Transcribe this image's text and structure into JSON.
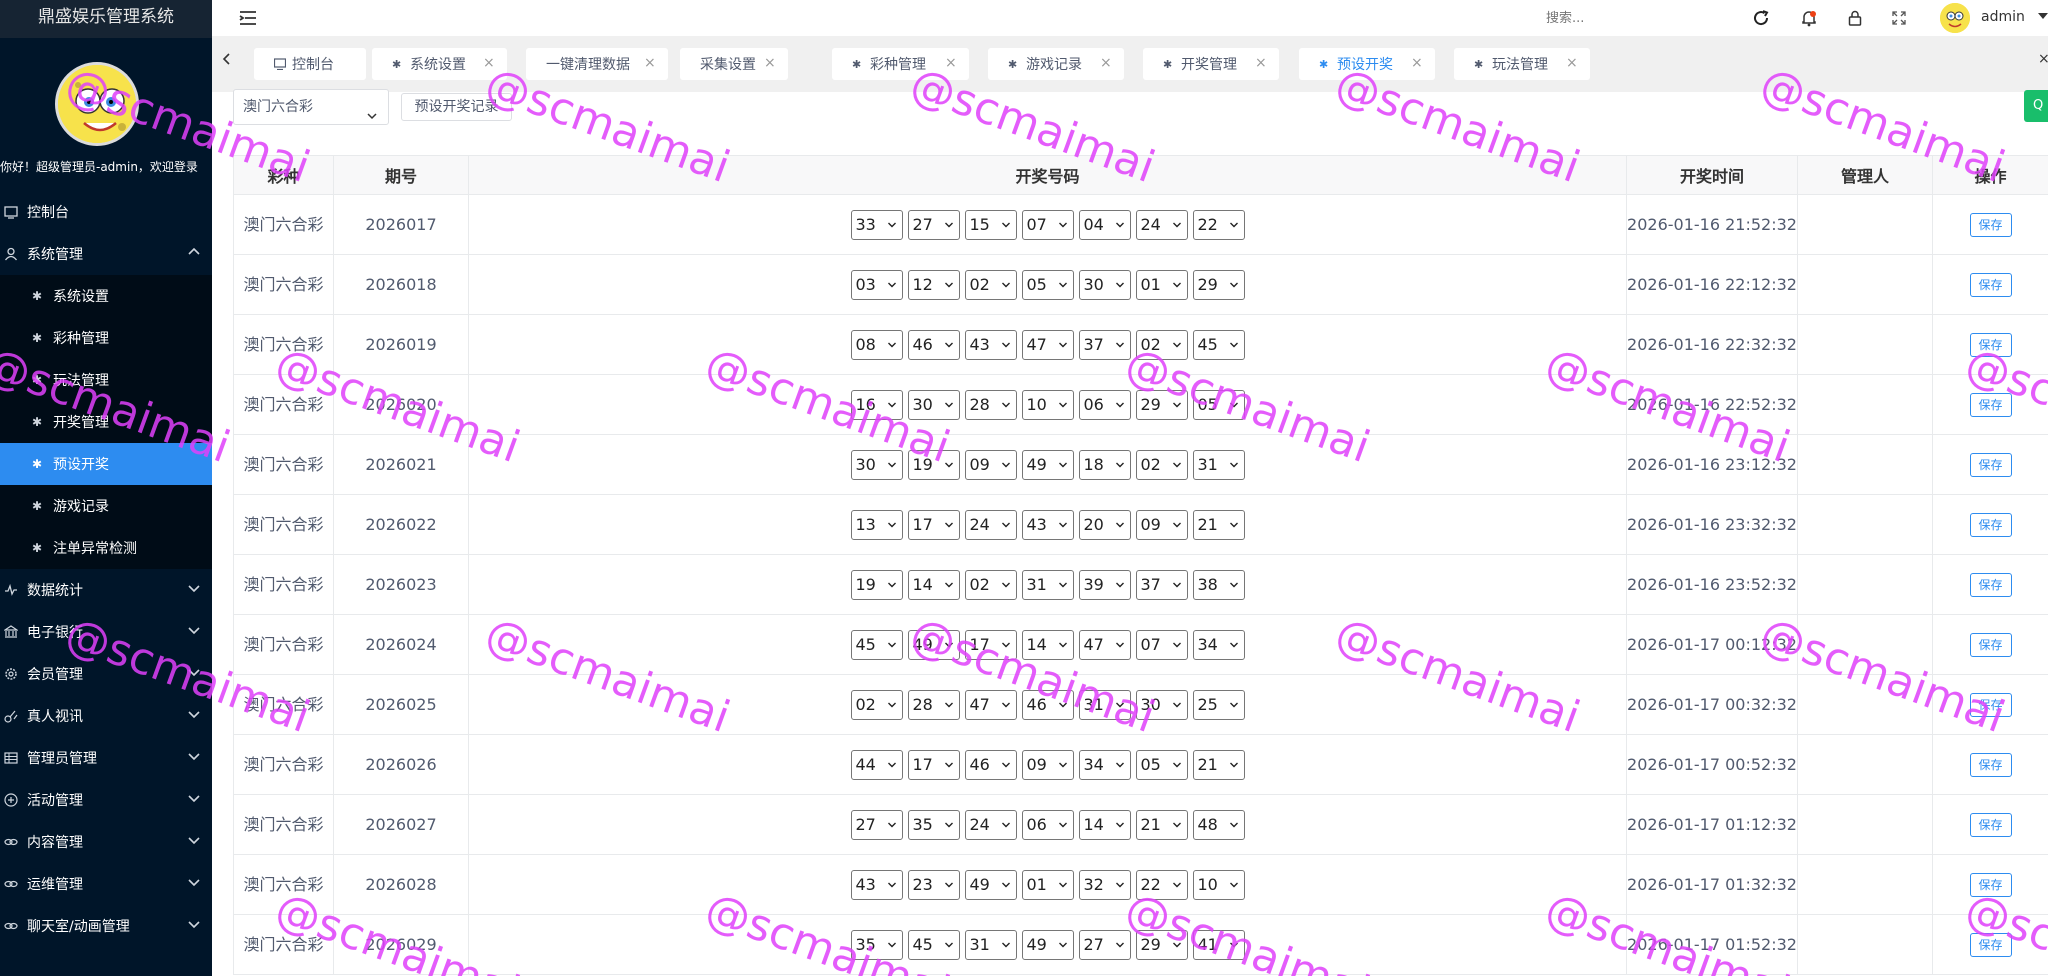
{
  "app": {
    "title": "鼎盛娱乐管理系统"
  },
  "sidebar": {
    "greeting": "你好！超级管理员-admin，欢迎登录",
    "items": [
      {
        "label": "控制台",
        "icon": "dashboard-icon",
        "expandable": false
      },
      {
        "label": "系统管理",
        "icon": "user-icon",
        "expandable": true,
        "expanded": true
      },
      {
        "label": "数据统计",
        "icon": "pulse-icon",
        "expandable": true
      },
      {
        "label": "电子银行",
        "icon": "bank-icon",
        "expandable": true
      },
      {
        "label": "会员管理",
        "icon": "gear-icon",
        "expandable": true
      },
      {
        "label": "真人视讯",
        "icon": "video-icon",
        "expandable": true
      },
      {
        "label": "管理员管理",
        "icon": "grid-icon",
        "expandable": true
      },
      {
        "label": "活动管理",
        "icon": "plus-circle-icon",
        "expandable": true
      },
      {
        "label": "内容管理",
        "icon": "link-icon",
        "expandable": true
      },
      {
        "label": "运维管理",
        "icon": "link-icon",
        "expandable": true
      },
      {
        "label": "聊天室/动画管理",
        "icon": "link-icon",
        "expandable": true
      }
    ],
    "submenu": [
      {
        "label": "系统设置",
        "active": false
      },
      {
        "label": "彩种管理",
        "active": false
      },
      {
        "label": "玩法管理",
        "active": false
      },
      {
        "label": "开奖管理",
        "active": false
      },
      {
        "label": "预设开奖",
        "active": true
      },
      {
        "label": "游戏记录",
        "active": false
      },
      {
        "label": "注单异常检测",
        "active": false
      }
    ]
  },
  "header": {
    "search_placeholder": "搜索...",
    "username": "admin"
  },
  "tabs": [
    {
      "label": "控制台",
      "closable": false,
      "active": false
    },
    {
      "label": "系统设置",
      "closable": true,
      "active": false
    },
    {
      "label": "一键清理数据",
      "closable": true,
      "active": false
    },
    {
      "label": "采集设置",
      "closable": true,
      "active": false
    },
    {
      "label": "彩种管理",
      "closable": true,
      "active": false
    },
    {
      "label": "游戏记录",
      "closable": true,
      "active": false
    },
    {
      "label": "开奖管理",
      "closable": true,
      "active": false
    },
    {
      "label": "预设开奖",
      "closable": true,
      "active": true
    },
    {
      "label": "玩法管理",
      "closable": true,
      "active": false
    }
  ],
  "toolbar": {
    "lottery_select": "澳门六合彩",
    "history_button": "预设开奖记录",
    "green_button": "Q"
  },
  "table": {
    "headers": [
      "彩种",
      "期号",
      "开奖号码",
      "开奖时间",
      "管理人",
      "操作"
    ],
    "save_label": "保存",
    "rows": [
      {
        "kind": "澳门六合彩",
        "issue": "2026017",
        "balls": [
          "33",
          "27",
          "15",
          "07",
          "04",
          "24",
          "22"
        ],
        "time": "2026-01-16 21:52:32",
        "manager": ""
      },
      {
        "kind": "澳门六合彩",
        "issue": "2026018",
        "balls": [
          "03",
          "12",
          "02",
          "05",
          "30",
          "01",
          "29"
        ],
        "time": "2026-01-16 22:12:32",
        "manager": ""
      },
      {
        "kind": "澳门六合彩",
        "issue": "2026019",
        "balls": [
          "08",
          "46",
          "43",
          "47",
          "37",
          "02",
          "45"
        ],
        "time": "2026-01-16 22:32:32",
        "manager": ""
      },
      {
        "kind": "澳门六合彩",
        "issue": "2026020",
        "balls": [
          "16",
          "30",
          "28",
          "10",
          "06",
          "29",
          "05"
        ],
        "time": "2026-01-16 22:52:32",
        "manager": ""
      },
      {
        "kind": "澳门六合彩",
        "issue": "2026021",
        "balls": [
          "30",
          "19",
          "09",
          "49",
          "18",
          "02",
          "31"
        ],
        "time": "2026-01-16 23:12:32",
        "manager": ""
      },
      {
        "kind": "澳门六合彩",
        "issue": "2026022",
        "balls": [
          "13",
          "17",
          "24",
          "43",
          "20",
          "09",
          "21"
        ],
        "time": "2026-01-16 23:32:32",
        "manager": ""
      },
      {
        "kind": "澳门六合彩",
        "issue": "2026023",
        "balls": [
          "19",
          "14",
          "02",
          "31",
          "39",
          "37",
          "38"
        ],
        "time": "2026-01-16 23:52:32",
        "manager": ""
      },
      {
        "kind": "澳门六合彩",
        "issue": "2026024",
        "balls": [
          "45",
          "49",
          "17",
          "14",
          "47",
          "07",
          "34"
        ],
        "time": "2026-01-17 00:12:32",
        "manager": ""
      },
      {
        "kind": "澳门六合彩",
        "issue": "2026025",
        "balls": [
          "02",
          "28",
          "47",
          "46",
          "31",
          "30",
          "25"
        ],
        "time": "2026-01-17 00:32:32",
        "manager": ""
      },
      {
        "kind": "澳门六合彩",
        "issue": "2026026",
        "balls": [
          "44",
          "17",
          "46",
          "09",
          "34",
          "05",
          "21"
        ],
        "time": "2026-01-17 00:52:32",
        "manager": ""
      },
      {
        "kind": "澳门六合彩",
        "issue": "2026027",
        "balls": [
          "27",
          "35",
          "24",
          "06",
          "14",
          "21",
          "48"
        ],
        "time": "2026-01-17 01:12:32",
        "manager": ""
      },
      {
        "kind": "澳门六合彩",
        "issue": "2026028",
        "balls": [
          "43",
          "23",
          "49",
          "01",
          "32",
          "22",
          "10"
        ],
        "time": "2026-01-17 01:32:32",
        "manager": ""
      },
      {
        "kind": "澳门六合彩",
        "issue": "2026029",
        "balls": [
          "35",
          "45",
          "31",
          "49",
          "27",
          "29",
          "41"
        ],
        "time": "2026-01-17 01:52:32",
        "manager": ""
      }
    ]
  },
  "watermark": {
    "text": "@scmaimai",
    "color": "#e040fb"
  },
  "colors": {
    "sidebar_bg": "#001529",
    "active_blue": "#2d8cf0",
    "green": "#19be6b"
  }
}
